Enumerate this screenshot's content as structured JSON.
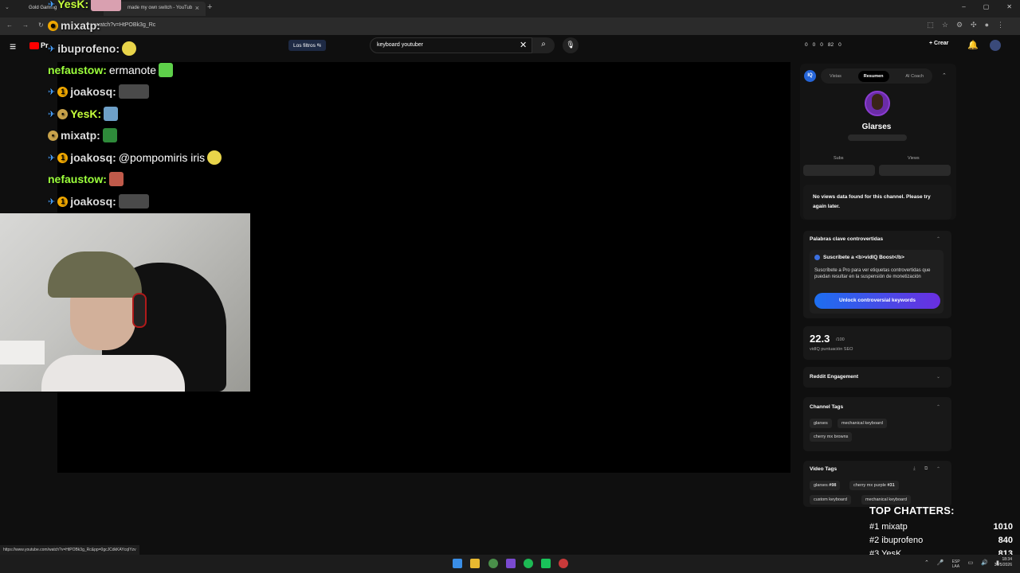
{
  "browser": {
    "tab1_title": "Gold Gaming",
    "tab2_title": "made my own switch - YouTub",
    "url": "watch?v=HtPOBk3g_Rc",
    "status_url": "https://www.youtube.com/watch?v=HtPOBk3g_Rc&pp=0gcJCdkKAYcqIYzv"
  },
  "youtube": {
    "logo_text": "Pr",
    "filters_label": "Los filtros",
    "search_value": "keyboard youtuber",
    "stats": [
      "0",
      "0",
      "0",
      "82",
      "0"
    ],
    "create_label": "Crear"
  },
  "chat": [
    {
      "name": "ibuprofeno:",
      "msg": ""
    },
    {
      "name": "nefaustow:",
      "msg": "ermanote"
    },
    {
      "name": "joakosq:",
      "msg": ""
    },
    {
      "name": "YesK:",
      "msg": ""
    },
    {
      "name": "mixatp:",
      "msg": ""
    },
    {
      "name": "joakosq:",
      "msg": "@pompomiris iris"
    },
    {
      "name": "nefaustow:",
      "msg": ""
    },
    {
      "name": "joakosq:",
      "msg": ""
    }
  ],
  "chat_top": {
    "yesk": "YesK:",
    "mixatp": "mixatp:"
  },
  "vidiq": {
    "logo": "IQ",
    "tabs": [
      "Vistas",
      "Resumen",
      "AI Coach"
    ],
    "channel_name": "Glarses",
    "subs_label": "Subs",
    "views_label": "Views",
    "no_views_msg": "No views data found for this channel. Please try again later.",
    "controversial_title": "Palabras clave controvertidas",
    "boost_title": "Suscríbete a <b>vidIQ Boost</b>",
    "boost_desc": "Suscríbete a Pro para ver etiquetas controvertidas que puedan resultar en la suspensión de monetización",
    "unlock_label": "Unlock controversial keywords",
    "seo_score": "22.3",
    "seo_max": "/100",
    "seo_label": "vidIQ puntuación SEO",
    "reddit_title": "Reddit Engagement",
    "channel_tags_title": "Channel Tags",
    "channel_tags": [
      "glarses",
      "mechanical keyboard",
      "cherry mx browns"
    ],
    "video_tags_title": "Video Tags",
    "video_tags": [
      "glarses",
      "#98",
      "cherry mx purple",
      "#31",
      "custom keyboard",
      "mechanical keyboard"
    ]
  },
  "top_chatters": {
    "title": "TOP CHATTERS:",
    "rows": [
      {
        "rank": "#1 mixatp",
        "count": "1010"
      },
      {
        "rank": "#2 ibuprofeno",
        "count": "840"
      },
      {
        "rank": "#3 YesK",
        "count": "813"
      }
    ]
  },
  "taskbar": {
    "lang": "ESP",
    "lang2": "LAA",
    "time": "18:34",
    "date": "30/5/2026"
  }
}
